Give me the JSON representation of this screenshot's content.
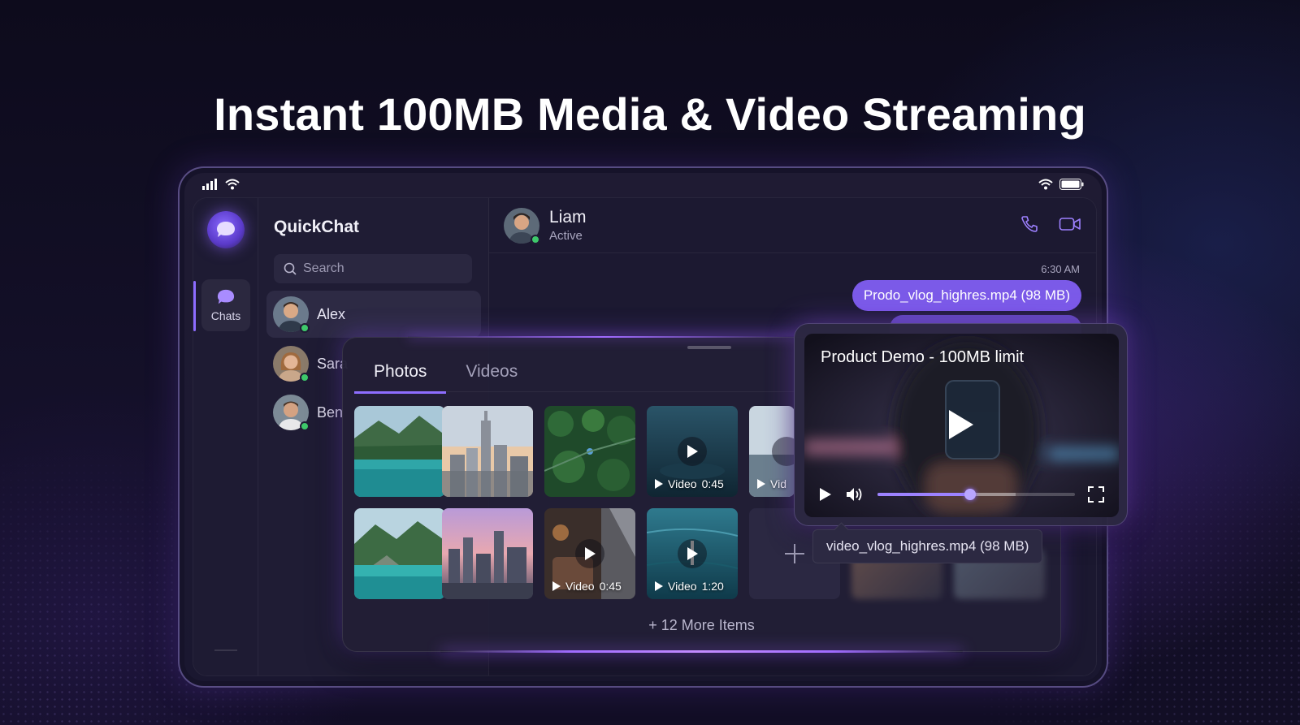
{
  "headline": "Instant 100MB Media & Video Streaming",
  "app": {
    "title": "QuickChat",
    "rail": {
      "chats_label": "Chats"
    },
    "search": {
      "placeholder": "Search"
    },
    "contacts": [
      {
        "name": "Alex",
        "online": true,
        "active": true
      },
      {
        "name": "Sara",
        "online": true,
        "active": false
      },
      {
        "name": "Ben",
        "online": true,
        "active": false
      }
    ]
  },
  "chat": {
    "contact_name": "Liam",
    "contact_status": "Active",
    "timestamp": "6:30 AM",
    "message": "Prodo_vlog_highres.mp4 (98 MB)"
  },
  "media_panel": {
    "tabs": [
      "Photos",
      "Videos"
    ],
    "active_tab": "Photos",
    "video_tiles": [
      {
        "label": "Video",
        "duration": "0:45"
      },
      {
        "label": "Vid",
        "duration": ""
      },
      {
        "label": "Video",
        "duration": "0:45"
      },
      {
        "label": "Video",
        "duration": "1:20"
      }
    ],
    "more_items": "+ 12 More Items"
  },
  "player": {
    "title": "Product Demo - 100MB limit",
    "progress": 0.47,
    "buffered": 0.7,
    "caption": "video_vlog_highres.mp4 (98 MB)"
  },
  "colors": {
    "accent": "#7b5ae8",
    "online": "#3ec96b",
    "background": "#120e25"
  }
}
